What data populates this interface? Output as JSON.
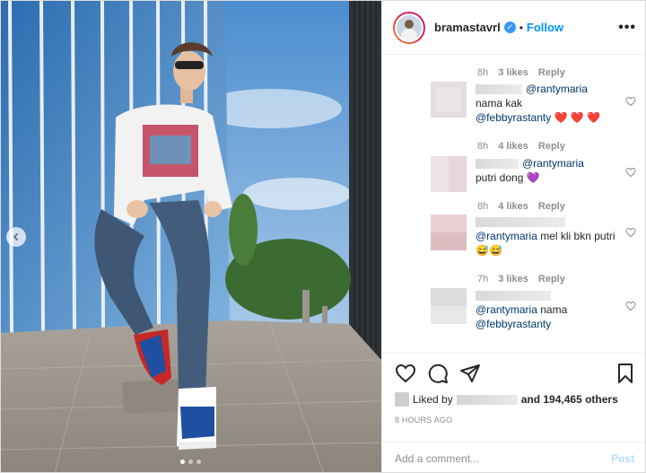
{
  "post": {
    "username": "bramastavrl",
    "separator": "•",
    "follow_label": "Follow",
    "more_label": "•••",
    "verified_mark": "✓"
  },
  "comments": [
    {
      "meta": {
        "time": "8h",
        "likes": "3 likes",
        "reply": "Reply"
      }
    },
    {
      "mention": "@rantymaria",
      "text": "nama kak",
      "mention2": "@febbyrastanty",
      "emoji": "❤️ ❤️ ❤️"
    },
    {
      "meta": {
        "time": "8h",
        "likes": "4 likes",
        "reply": "Reply"
      }
    },
    {
      "mention": "@rantymaria",
      "text": "putri dong",
      "emoji": "💜"
    },
    {
      "meta": {
        "time": "8h",
        "likes": "4 likes",
        "reply": "Reply"
      }
    },
    {
      "mention": "@rantymaria",
      "text": "mel kli bkn putri",
      "emoji": "😅😅"
    },
    {
      "meta": {
        "time": "7h",
        "likes": "3 likes",
        "reply": "Reply"
      }
    },
    {
      "mention": "@rantymaria",
      "text": "nama",
      "mention2": "@febbyrastanty"
    }
  ],
  "likes": {
    "prefix": "Liked by",
    "suffix": "and 194,465 others"
  },
  "time_ago": "8 HOURS AGO",
  "composer": {
    "placeholder": "Add a comment...",
    "post_label": "Post"
  },
  "carousel": {
    "current": 1,
    "total": 3
  },
  "colors": {
    "link": "#0095f6",
    "mention": "#00376b",
    "muted": "#8e8e8e",
    "heart": "#ed4956"
  },
  "icons": [
    "heart-icon",
    "comment-icon",
    "share-icon",
    "bookmark-icon",
    "more-icon",
    "verified-icon"
  ]
}
